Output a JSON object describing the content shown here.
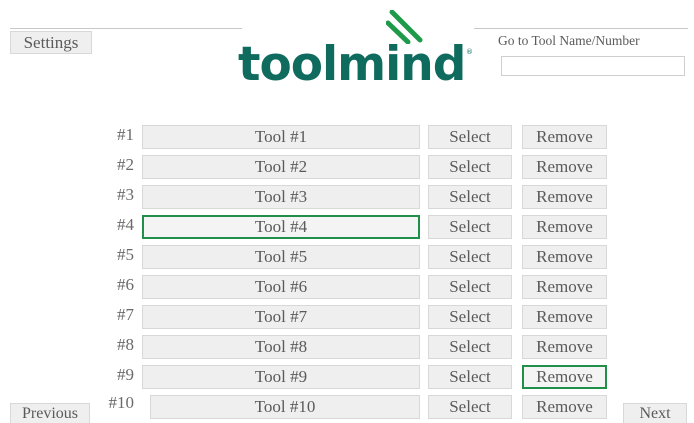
{
  "header": {
    "settings_label": "Settings",
    "goto_label": "Go to Tool Name/Number",
    "goto_value": ""
  },
  "logo": {
    "text": "toolmind",
    "registered": "®",
    "color": "#0f6b5e",
    "mark_color": "#1f9a4a"
  },
  "tools": [
    {
      "number": "#1",
      "name": "Tool #1",
      "select": "Select",
      "remove": "Remove"
    },
    {
      "number": "#2",
      "name": "Tool #2",
      "select": "Select",
      "remove": "Remove"
    },
    {
      "number": "#3",
      "name": "Tool #3",
      "select": "Select",
      "remove": "Remove"
    },
    {
      "number": "#4",
      "name": "Tool #4",
      "select": "Select",
      "remove": "Remove"
    },
    {
      "number": "#5",
      "name": "Tool #5",
      "select": "Select",
      "remove": "Remove"
    },
    {
      "number": "#6",
      "name": "Tool #6",
      "select": "Select",
      "remove": "Remove"
    },
    {
      "number": "#7",
      "name": "Tool #7",
      "select": "Select",
      "remove": "Remove"
    },
    {
      "number": "#8",
      "name": "Tool #8",
      "select": "Select",
      "remove": "Remove"
    },
    {
      "number": "#9",
      "name": "Tool #9",
      "select": "Select",
      "remove": "Remove"
    },
    {
      "number": "#10",
      "name": "Tool #10",
      "select": "Select",
      "remove": "Remove"
    }
  ],
  "highlight": {
    "name_button_row": "#4",
    "remove_button_row": "#9",
    "color": "#1f8f4a"
  },
  "nav": {
    "previous_label": "Previous",
    "next_label": "Next"
  }
}
